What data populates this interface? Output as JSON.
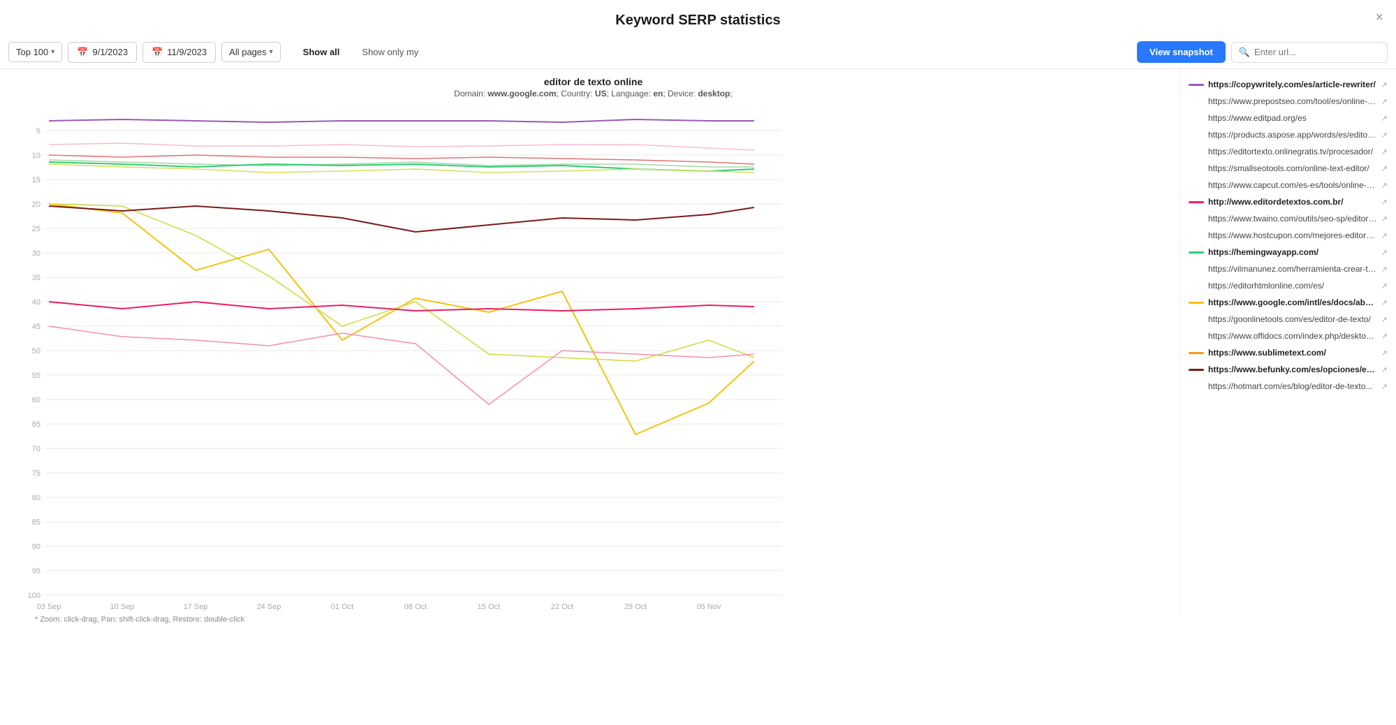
{
  "header": {
    "title": "Keyword SERP statistics",
    "close_label": "×"
  },
  "toolbar": {
    "top_label": "Top 100",
    "date_start": "9/1/2023",
    "date_end": "11/9/2023",
    "pages_label": "All pages",
    "show_all_label": "Show all",
    "show_only_my_label": "Show only my",
    "view_snapshot_label": "View snapshot",
    "url_placeholder": "Enter url..."
  },
  "chart": {
    "keyword": "editor de texto online",
    "domain_label": "Domain:",
    "domain_value": "www.google.com",
    "country_label": "Country:",
    "country_value": "US",
    "language_label": "Language:",
    "language_value": "en",
    "device_label": "Device:",
    "device_value": "desktop",
    "hint": "* Zoom: click-drag, Pan: shift-click-drag, Restore: double-click",
    "y_labels": [
      "5",
      "10",
      "15",
      "20",
      "25",
      "30",
      "35",
      "40",
      "45",
      "50",
      "55",
      "60",
      "65",
      "70",
      "75",
      "80",
      "85",
      "90",
      "95",
      "100"
    ],
    "x_labels": [
      "03 Sep",
      "10 Sep",
      "17 Sep",
      "24 Sep",
      "01 Oct",
      "08 Oct",
      "15 Oct",
      "22 Oct",
      "29 Oct",
      "05 Nov"
    ]
  },
  "legend": [
    {
      "color": "#9b59b6",
      "bold": true,
      "url": "https://copywritely.com/es/article-rewriter/"
    },
    {
      "color": "transparent",
      "bold": false,
      "url": "https://www.prepostseo.com/tool/es/online-te..."
    },
    {
      "color": "transparent",
      "bold": false,
      "url": "https://www.editpad.org/es"
    },
    {
      "color": "transparent",
      "bold": false,
      "url": "https://products.aspose.app/words/es/editor/txt"
    },
    {
      "color": "transparent",
      "bold": false,
      "url": "https://editortexto.onlinegratis.tv/procesador/"
    },
    {
      "color": "transparent",
      "bold": false,
      "url": "https://smallseotools.com/online-text-editor/"
    },
    {
      "color": "transparent",
      "bold": false,
      "url": "https://www.capcut.com/es-es/tools/online-te..."
    },
    {
      "color": "#e91e63",
      "bold": true,
      "url": "http://www.editordetextos.com.br/"
    },
    {
      "color": "transparent",
      "bold": false,
      "url": "https://www.twaino.com/outils/seo-sp/editor-..."
    },
    {
      "color": "transparent",
      "bold": false,
      "url": "https://www.hostcupon.com/mejores-editore..."
    },
    {
      "color": "#2ecc71",
      "bold": true,
      "url": "https://hemingwayapp.com/"
    },
    {
      "color": "transparent",
      "bold": false,
      "url": "https://vilmanunez.com/herramienta-crear-te..."
    },
    {
      "color": "transparent",
      "bold": false,
      "url": "https://editorhtmlonline.com/es/"
    },
    {
      "color": "#f1c40f",
      "bold": true,
      "url": "https://www.google.com/intl/es/docs/about/"
    },
    {
      "color": "transparent",
      "bold": false,
      "url": "https://goonlinetools.com/es/editor-de-texto/"
    },
    {
      "color": "transparent",
      "bold": false,
      "url": "https://www.offidocs.com/index.php/desktop-..."
    },
    {
      "color": "#f39c12",
      "bold": true,
      "url": "https://www.sublimetext.com/"
    },
    {
      "color": "#7b1a1a",
      "bold": true,
      "url": "https://www.befunky.com/es/opciones/editor-..."
    },
    {
      "color": "transparent",
      "bold": false,
      "url": "https://hotmart.com/es/blog/editor-de-texto..."
    }
  ]
}
